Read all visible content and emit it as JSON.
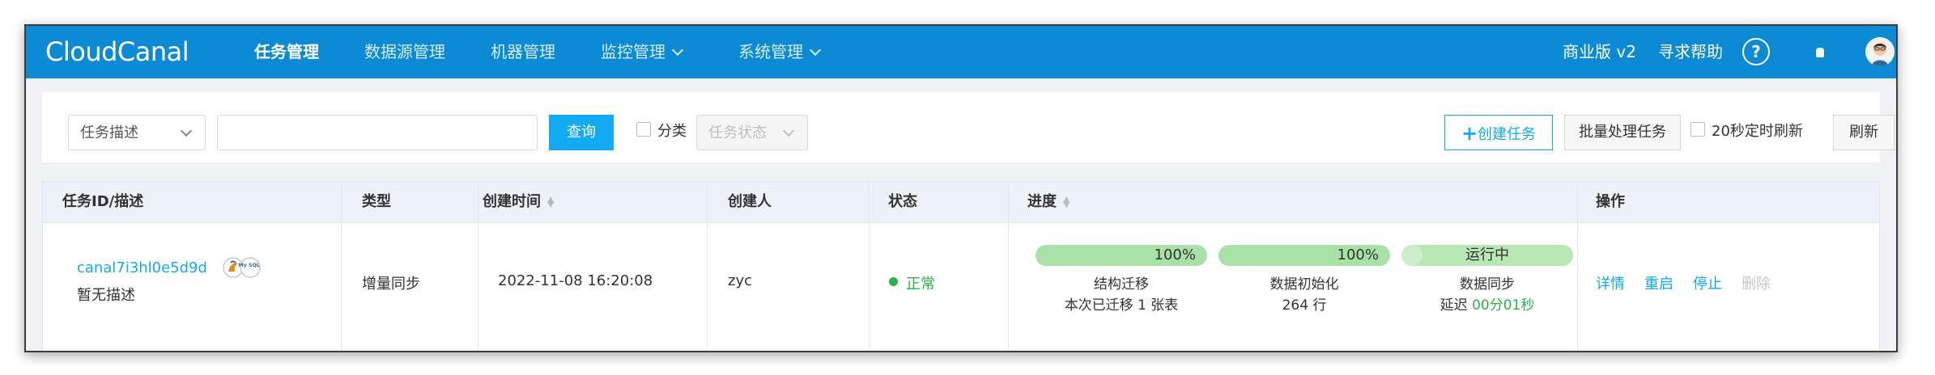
{
  "app": {
    "logo": "CloudCanal"
  },
  "nav": {
    "items": [
      {
        "label": "任务管理",
        "active": true
      },
      {
        "label": "数据源管理",
        "active": false
      },
      {
        "label": "机器管理",
        "active": false
      },
      {
        "label": "监控管理",
        "active": false
      },
      {
        "label": "系统管理",
        "active": false
      }
    ],
    "edition": "商业版 v2",
    "help": "寻求帮助",
    "help_icon": "?"
  },
  "filters": {
    "field_select": "任务描述",
    "search_value": "",
    "query_button": "查询",
    "category_label": "分类",
    "status_placeholder": "任务状态",
    "create_button": "创建任务",
    "batch_button": "批量处理任务",
    "auto_refresh_label": "20秒定时刷新",
    "refresh_button": "刷新"
  },
  "table": {
    "headers": {
      "id": "任务ID/描述",
      "type": "类型",
      "created_time": "创建时间",
      "creator": "创建人",
      "status": "状态",
      "progress": "进度",
      "ops": "操作"
    },
    "rows": [
      {
        "task_id": "canal7i3hl0e5d9d",
        "db_badge": "My SQL",
        "description": "暂无描述",
        "type": "增量同步",
        "created_time": "2022-11-08 16:20:08",
        "creator": "zyc",
        "status": "正常",
        "progress": {
          "struct_pct": "100%",
          "struct_label": "结构迁移",
          "struct_detail": "本次已迁移 1 张表",
          "init_pct": "100%",
          "init_label": "数据初始化",
          "init_detail": "264 行",
          "sync_state": "运行中",
          "sync_label": "数据同步",
          "sync_delay_prefix": "延迟 ",
          "sync_delay": "00分01秒"
        },
        "ops": {
          "detail": "详情",
          "restart": "重启",
          "stop": "停止",
          "delete": "删除"
        }
      }
    ]
  },
  "colors": {
    "topbar": "#0c8bd4",
    "accent": "#12aaf0",
    "status_ok": "#28b446",
    "progress_fill": "#a7e1a5"
  }
}
